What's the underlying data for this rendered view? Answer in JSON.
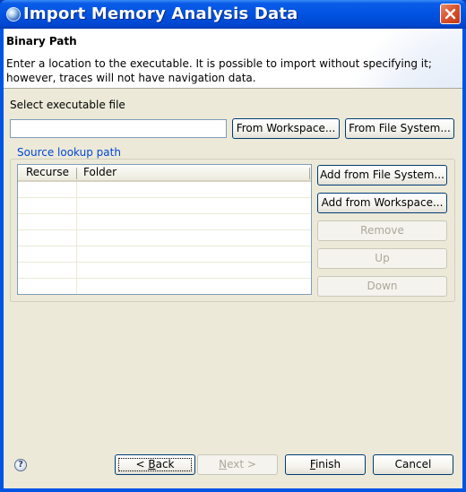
{
  "window": {
    "title": "Import Memory Analysis Data",
    "app_icon": "eclipse-icon",
    "close_icon": "close-icon"
  },
  "banner": {
    "title": "Binary Path",
    "description": "Enter a location to the executable. It is possible to import without specifying it; however, traces will not have navigation data."
  },
  "executable": {
    "label": "Select executable file",
    "value": "",
    "placeholder": "",
    "from_workspace_label": "From Workspace...",
    "from_file_system_label": "From File System..."
  },
  "source_lookup": {
    "group_label": "Source lookup path",
    "columns": [
      "Recurse",
      "Folder"
    ],
    "rows": [],
    "buttons": {
      "add_from_file_system": "Add from File System...",
      "add_from_workspace": "Add from Workspace...",
      "remove": "Remove",
      "up": "Up",
      "down": "Down"
    }
  },
  "footer": {
    "help_icon": "help-icon",
    "back": {
      "prefix": "< ",
      "mnemonic": "B",
      "rest": "ack"
    },
    "next": {
      "mnemonic": "N",
      "rest": "ext >"
    },
    "finish": {
      "mnemonic": "F",
      "rest": "inish"
    },
    "cancel": "Cancel"
  }
}
